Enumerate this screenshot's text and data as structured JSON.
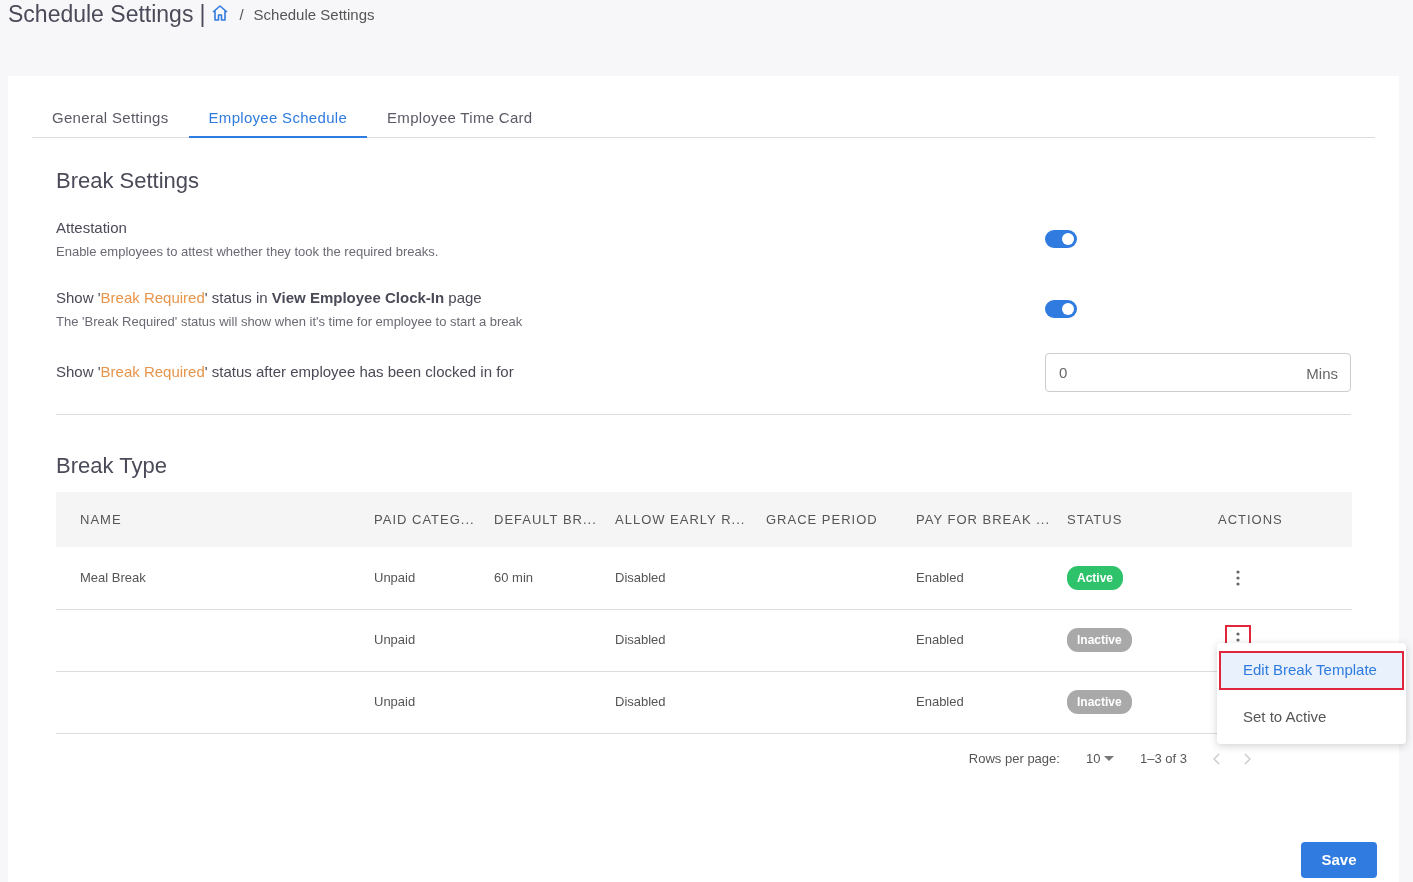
{
  "header": {
    "title": "Schedule Settings",
    "separator": "|",
    "breadcrumb": [
      {
        "kind": "home"
      },
      {
        "kind": "text",
        "label": "/"
      },
      {
        "kind": "text",
        "label": "Schedule Settings"
      }
    ]
  },
  "tabs": [
    {
      "label": "General Settings",
      "selected": false
    },
    {
      "label": "Employee Schedule",
      "selected": true
    },
    {
      "label": "Employee Time Card",
      "selected": false
    }
  ],
  "break_settings": {
    "title": "Break Settings",
    "settings": [
      {
        "kind": "toggle",
        "label": [
          {
            "kind": "plain",
            "text": "Attestation"
          }
        ],
        "description": "Enable employees to attest whether they took the required breaks.",
        "on": true
      },
      {
        "kind": "toggle",
        "label": [
          {
            "kind": "plain",
            "text": "Show '"
          },
          {
            "kind": "highlight",
            "text": "Break Required"
          },
          {
            "kind": "plain",
            "text": "' status in "
          },
          {
            "kind": "bold",
            "text": "View Employee Clock-In"
          },
          {
            "kind": "plain",
            "text": " page"
          }
        ],
        "description": "The 'Break Required' status will show when it's time for employee to start a break",
        "on": true
      },
      {
        "kind": "input",
        "label": [
          {
            "kind": "plain",
            "text": "Show '"
          },
          {
            "kind": "highlight",
            "text": "Break Required"
          },
          {
            "kind": "plain",
            "text": "' status after employee has been clocked in for"
          }
        ],
        "value": "0",
        "unit": "Mins"
      }
    ]
  },
  "break_type": {
    "title": "Break Type",
    "columns": [
      "NAME",
      "PAID CATEG...",
      "DEFAULT BR...",
      "ALLOW EARLY R...",
      "GRACE PERIOD",
      "PAY FOR BREAK ...",
      "STATUS",
      "ACTIONS"
    ],
    "rows": [
      {
        "cells": [
          "Meal Break",
          "Unpaid",
          "60 min",
          "Disabled",
          "",
          "Enabled"
        ],
        "status": {
          "label": "Active",
          "kind": "active"
        },
        "actions_focused": false
      },
      {
        "cells": [
          "",
          "Unpaid",
          "",
          "Disabled",
          "",
          "Enabled"
        ],
        "status": {
          "label": "Inactive",
          "kind": "inactive"
        },
        "actions_focused": true
      },
      {
        "cells": [
          "",
          "Unpaid",
          "",
          "Disabled",
          "",
          "Enabled"
        ],
        "status": {
          "label": "Inactive",
          "kind": "inactive"
        }
      }
    ],
    "menu": [
      {
        "label": "Edit Break Template",
        "selected": true
      },
      {
        "label": "Set to Active",
        "selected": false
      }
    ],
    "pagination": {
      "rows_label": "Rows per page:",
      "rows_value": "10",
      "range": "1–3 of 3"
    }
  },
  "save_button": "Save"
}
